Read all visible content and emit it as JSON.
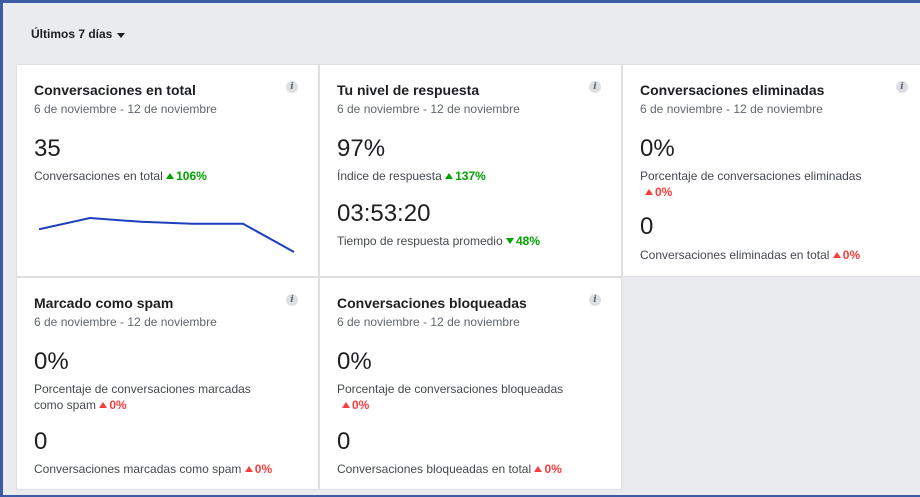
{
  "range_label": "Últimos 7 días",
  "date_range": "6 de noviembre - 12 de noviembre",
  "info_glyph": "i",
  "cards": {
    "total": {
      "title": "Conversaciones en total",
      "value": "35",
      "caption": "Conversaciones en total",
      "change": "106%",
      "change_dir": "up",
      "sparkline": [
        27,
        30,
        29,
        28.5,
        28.5,
        21
      ]
    },
    "response": {
      "title": "Tu nivel de respuesta",
      "value": "97%",
      "caption": "Índice de respuesta",
      "change": "137%",
      "value2": "03:53:20",
      "caption2": "Tiempo de respuesta promedio",
      "change2": "48%"
    },
    "deleted": {
      "title": "Conversaciones eliminadas",
      "value": "0%",
      "caption": "Porcentaje de conversaciones eliminadas",
      "change": "0%",
      "value2": "0",
      "caption2": "Conversaciones eliminadas en total",
      "change2": "0%"
    },
    "spam": {
      "title": "Marcado como spam",
      "value": "0%",
      "caption_l1": "Porcentaje de conversaciones marcadas",
      "caption_l2": "como spam",
      "change": "0%",
      "value2": "0",
      "caption2": "Conversaciones marcadas como spam",
      "change2": "0%"
    },
    "blocked": {
      "title": "Conversaciones bloqueadas",
      "value": "0%",
      "caption": "Porcentaje de conversaciones bloqueadas",
      "change": "0%",
      "value2": "0",
      "caption2": "Conversaciones bloqueadas en total",
      "change2": "0%"
    }
  },
  "colors": {
    "positive": "#00a400",
    "negative": "#fa3e3e",
    "sparkline": "#1d3fbf",
    "border_accent": "#3b5ba5"
  }
}
